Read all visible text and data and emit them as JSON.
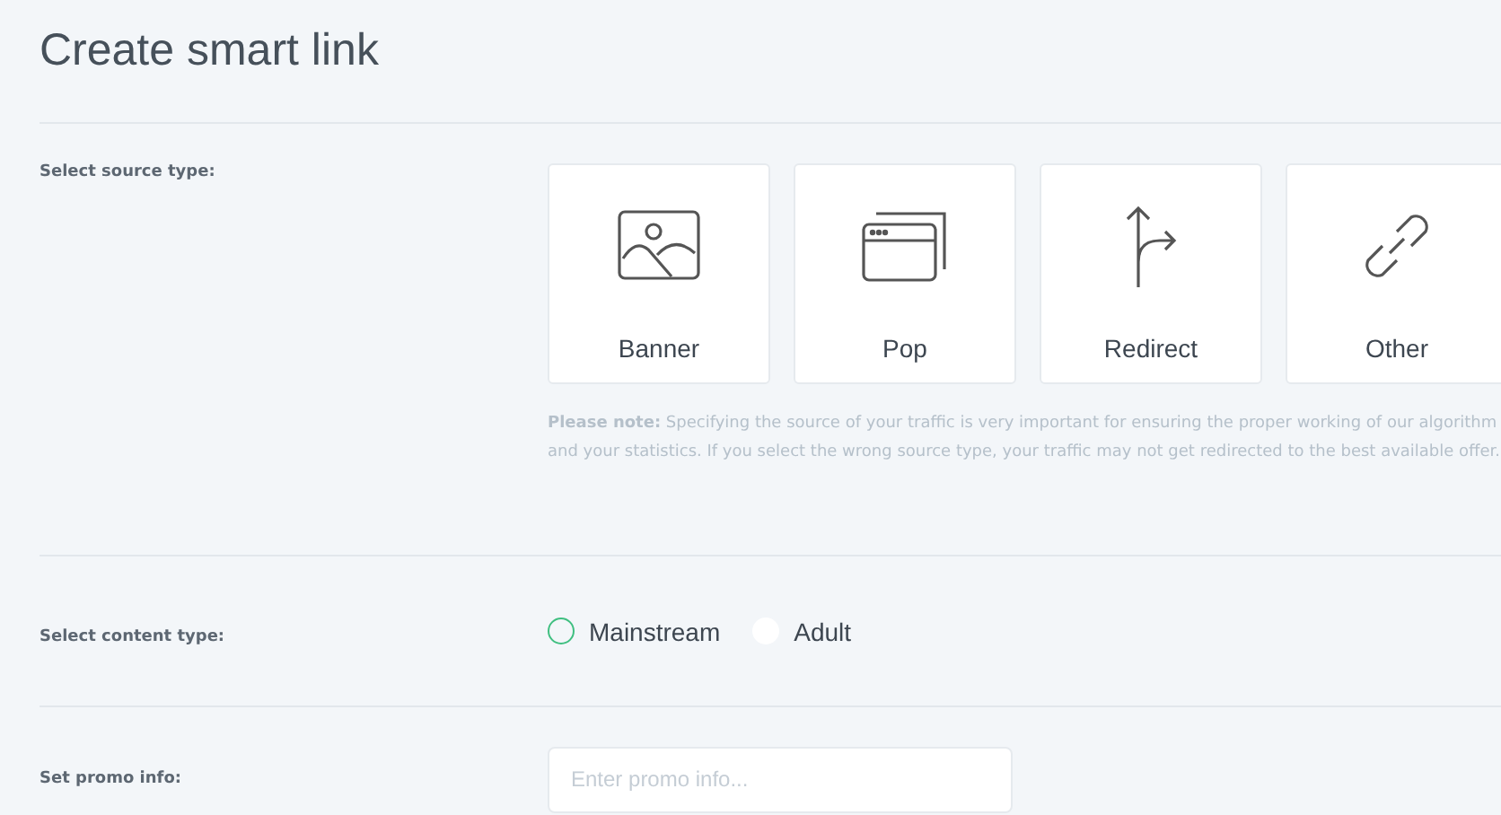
{
  "title": "Create smart link",
  "source": {
    "label": "Select source type:",
    "options": [
      {
        "kind": "banner",
        "label": "Banner",
        "selected": false
      },
      {
        "kind": "popup",
        "label": "Pop",
        "selected": false
      },
      {
        "kind": "redirect",
        "label": "Redirect",
        "selected": false
      },
      {
        "kind": "other",
        "label": "Other",
        "selected": false
      }
    ],
    "note": "**Please note:** Specifying the source of your traffic is very important for ensuring the proper working of our algorithm and your statistics. If you select the wrong source type, your traffic may not get redirected to the best available offer."
  },
  "content": {
    "label": "Select content type:",
    "options": [
      {
        "label": "Mainstream",
        "focused": true
      },
      {
        "label": "Adult",
        "focused": false
      }
    ]
  },
  "promo": {
    "label": "Set promo info:",
    "placeholder": "Enter promo info..."
  }
}
